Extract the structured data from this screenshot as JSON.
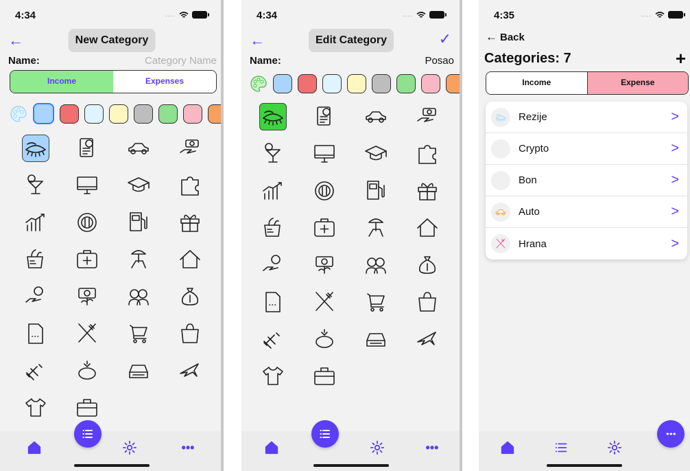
{
  "screens": [
    {
      "time": "4:34",
      "title": "New Category",
      "name_label": "Name:",
      "name_value": "",
      "name_placeholder": "Category Name",
      "segments": [
        "Income",
        "Expenses"
      ],
      "selected_segment": "Income"
    },
    {
      "time": "4:34",
      "title": "Edit Category",
      "name_label": "Name:",
      "name_value": "Posao",
      "name_placeholder": "Category Name"
    },
    {
      "time": "4:35",
      "back_label": "Back",
      "title": "Categories: 7",
      "segments": [
        "Income",
        "Expense"
      ],
      "selected_segment": "Expense",
      "categories": [
        {
          "name": "Rezije",
          "icon": "eye-lashes-icon",
          "color": "#8fd0ff"
        },
        {
          "name": "Crypto",
          "icon": "lips-icon",
          "color": "#f06b6b"
        },
        {
          "name": "Bon",
          "icon": "money-bill-icon",
          "color": "#7fd07f"
        },
        {
          "name": "Auto",
          "icon": "car-icon",
          "color": "#f0a030"
        },
        {
          "name": "Hrana",
          "icon": "fork-knife-icon",
          "color": "#e04a8a"
        }
      ]
    }
  ],
  "colors": {
    "accent": "#5b3ef5",
    "income_active": "#8fea8f",
    "expense_active": "#f7a8b4",
    "swatches": [
      "#a8d4ff",
      "#f07070",
      "#dff4ff",
      "#fff6c0",
      "#bdbdbd",
      "#8fe08f",
      "#f7b7c3",
      "#f7a060"
    ]
  },
  "icons": [
    "eye-lashes-icon",
    "bill-dollar-icon",
    "car-icon",
    "hand-money-icon",
    "cocktail-icon",
    "monitor-icon",
    "graduation-cap-icon",
    "puzzle-icon",
    "growth-chart-icon",
    "plate-cutlery-icon",
    "fuel-pump-icon",
    "gift-icon",
    "grocery-bag-icon",
    "first-aid-icon",
    "beach-chair-icon",
    "house-icon",
    "hand-coin-icon",
    "money-plant-icon",
    "couple-icon",
    "money-bag-icon",
    "document-icon",
    "fork-knife-icon",
    "cart-icon",
    "shopping-bag-icon",
    "dumbbell-icon",
    "tax-piggy-icon",
    "car-front-icon",
    "airplane-icon",
    "tshirt-icon",
    "briefcase-icon"
  ]
}
